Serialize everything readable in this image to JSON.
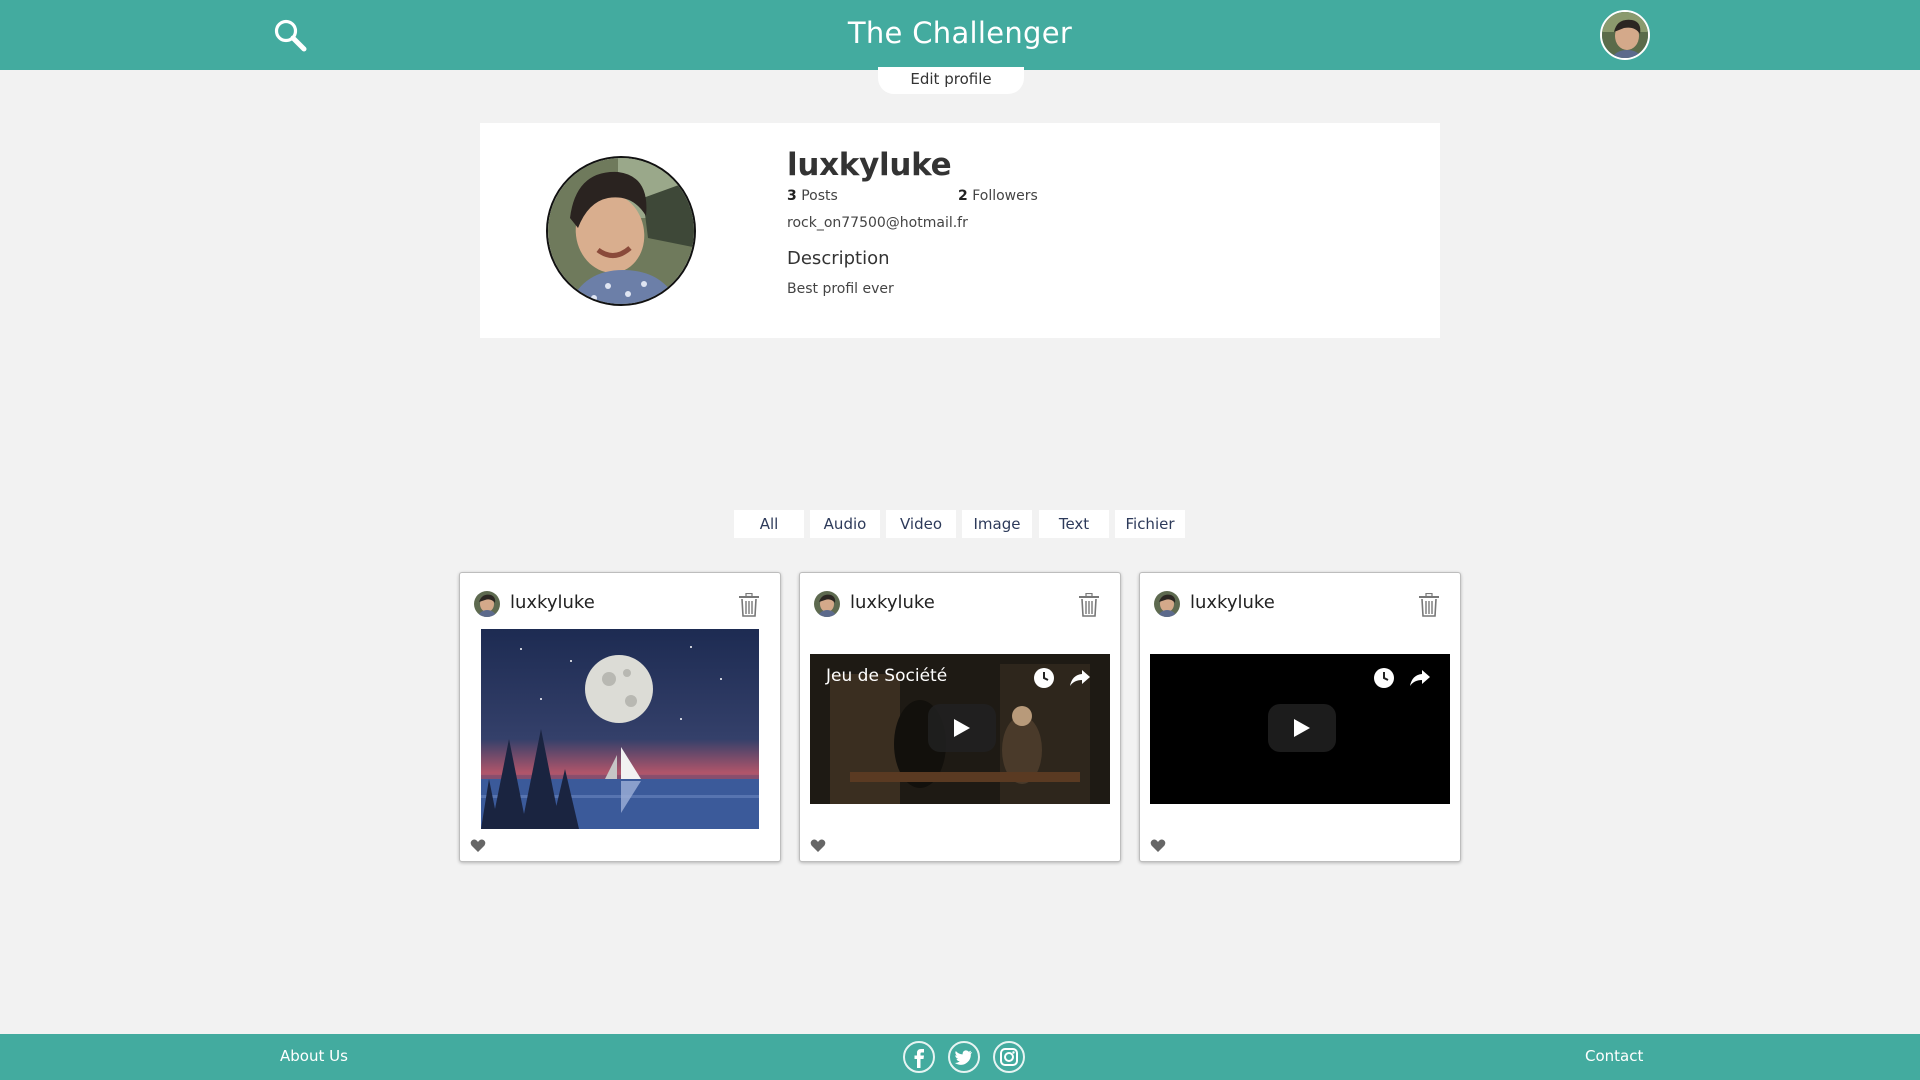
{
  "header": {
    "title": "The Challenger",
    "search_icon": "search-icon",
    "accent_color": "#43ab9f"
  },
  "profile": {
    "edit_label": "Edit profile",
    "username": "luxkyluke",
    "posts_count": "3",
    "posts_label": "Posts",
    "followers_count": "2",
    "followers_label": "Followers",
    "email": "rock_on77500@hotmail.fr",
    "description_title": "Description",
    "description": "Best profil ever"
  },
  "filters": [
    "All",
    "Audio",
    "Video",
    "Image",
    "Text",
    "Fichier"
  ],
  "posts": [
    {
      "username": "luxkyluke",
      "media": "image"
    },
    {
      "username": "luxkyluke",
      "media": "video",
      "video_title": "Jeu de Société"
    },
    {
      "username": "luxkyluke",
      "media": "video",
      "video_title": ""
    }
  ],
  "footer": {
    "about": "About Us",
    "contact": "Contact",
    "social": [
      "facebook-icon",
      "twitter-icon",
      "instagram-icon"
    ]
  }
}
